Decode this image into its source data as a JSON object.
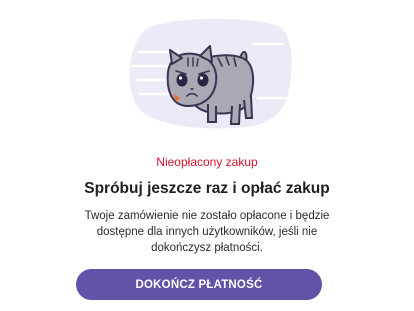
{
  "illustration": {
    "icon": "sad-cat-icon"
  },
  "payment": {
    "status_label": "Nieopłacony zakup",
    "title": "Spróbuj jeszcze raz i opłać zakup",
    "description": "Twoje zamówienie nie zostało opłacone i będzie dostępne dla innych użytkowników, jeśli nie dokończysz płatności.",
    "button_label": "DOKOŃCZ PŁATNOŚĆ"
  },
  "colors": {
    "accent": "#6451a8",
    "error": "#d0142c",
    "illustration_bg": "#eceaf6"
  }
}
